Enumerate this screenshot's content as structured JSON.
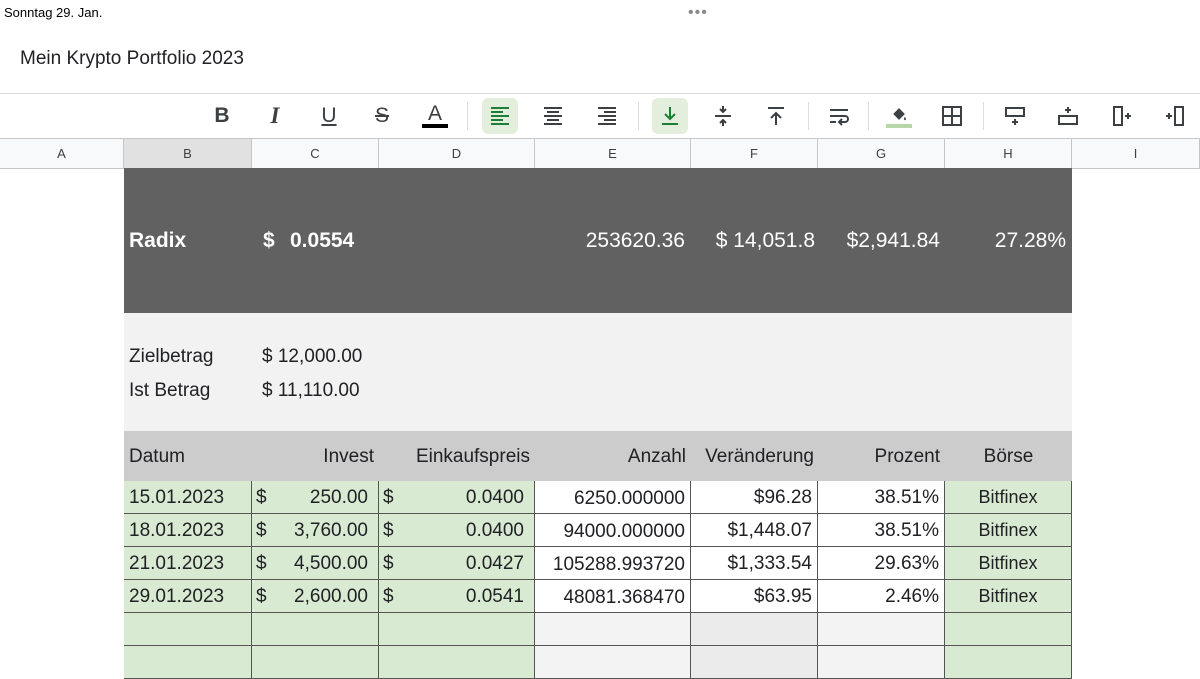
{
  "status_bar": {
    "date": "Sonntag 29. Jan.",
    "dots": "•••"
  },
  "document": {
    "title": "Mein Krypto Portfolio 2023"
  },
  "toolbar": {
    "bold": "B",
    "italic": "I",
    "underline": "U",
    "strikethrough": "S",
    "text_color": "A",
    "text_color_value": "#000000"
  },
  "columns": [
    "A",
    "B",
    "C",
    "D",
    "E",
    "F",
    "G",
    "H",
    "I"
  ],
  "banner": {
    "name": "Radix",
    "price_currency": "$",
    "price": "0.0554",
    "amount": "253620.36",
    "value": "$ 14,051.8",
    "change": "$2,941.84",
    "percent": "27.28%"
  },
  "target": {
    "goal_label": "Zielbetrag",
    "goal_value": "$ 12,000.00",
    "actual_label": "Ist Betrag",
    "actual_value": "$ 11,110.00"
  },
  "table_headers": {
    "date": "Datum",
    "invest": "Invest",
    "buy_price": "Einkaufspreis",
    "amount": "Anzahl",
    "change": "Veränderung",
    "percent": "Prozent",
    "exchange": "Börse"
  },
  "rows": [
    {
      "date": "15.01.2023",
      "invest_cur": "$",
      "invest": "250.00",
      "price_cur": "$",
      "price": "0.0400",
      "amount": "6250.000000",
      "change": "$96.28",
      "percent": "38.51%",
      "exchange": "Bitfinex"
    },
    {
      "date": "18.01.2023",
      "invest_cur": "$",
      "invest": "3,760.00",
      "price_cur": "$",
      "price": "0.0400",
      "amount": "94000.000000",
      "change": "$1,448.07",
      "percent": "38.51%",
      "exchange": "Bitfinex"
    },
    {
      "date": "21.01.2023",
      "invest_cur": "$",
      "invest": "4,500.00",
      "price_cur": "$",
      "price": "0.0427",
      "amount": "105288.993720",
      "change": "$1,333.54",
      "percent": "29.63%",
      "exchange": "Bitfinex"
    },
    {
      "date": "29.01.2023",
      "invest_cur": "$",
      "invest": "2,600.00",
      "price_cur": "$",
      "price": "0.0541",
      "amount": "48081.368470",
      "change": "$63.95",
      "percent": "2.46%",
      "exchange": "Bitfinex"
    }
  ],
  "colors": {
    "banner": "#616161",
    "green_cell": "#d9ead3",
    "header_row": "#cccccc",
    "target_bg": "#f2f2f2",
    "active_tool": "#e3eedd"
  }
}
